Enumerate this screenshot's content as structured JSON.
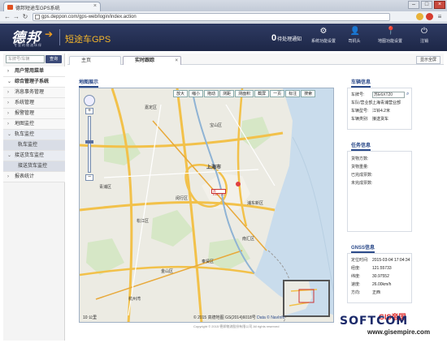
{
  "browser": {
    "tab_title": "德邦短途车GPS系统",
    "url": "gps.deppon.com/gps-web/login/index.action",
    "back_icon": "back-icon",
    "forward_icon": "forward-icon",
    "reload_icon": "reload-icon"
  },
  "header": {
    "logo_text": "德邦",
    "logo_sub": "专业的物流伙伴",
    "app_title": "短途车GPS",
    "alert_count": "0",
    "alert_label": "待处理通知",
    "items": [
      {
        "label": "系统功能设置",
        "icon": "gear-icon"
      },
      {
        "label": "司机头",
        "icon": "user-icon"
      },
      {
        "label": "地图功能设置",
        "icon": "map-pin-icon"
      },
      {
        "label": "注销",
        "icon": "power-icon"
      }
    ]
  },
  "sidebar": {
    "search_placeholder": "车牌号/车辆",
    "search_button": "查询",
    "items": [
      {
        "label": "用户常用菜单",
        "level": "top"
      },
      {
        "label": "综合管理子系统",
        "level": "top"
      },
      {
        "label": "消息事务管理",
        "level": "sub"
      },
      {
        "label": "系统管理",
        "level": "sub"
      },
      {
        "label": "报警管理",
        "level": "sub"
      },
      {
        "label": "地图监控",
        "level": "sub"
      },
      {
        "label": "轨车监控",
        "level": "sub"
      },
      {
        "label": "轨车监控",
        "level": "leaf"
      },
      {
        "label": "接送货车监控",
        "level": "sub"
      },
      {
        "label": "接送货车监控",
        "level": "leaf"
      },
      {
        "label": "报表统计",
        "level": "sub"
      }
    ]
  },
  "main": {
    "tabs": [
      {
        "label": "主页",
        "closable": false,
        "active": false
      },
      {
        "label": "实时跟踪",
        "closable": true,
        "active": true
      }
    ],
    "fullscreen_label": "显示全屏",
    "map_panel_title": "地图展示",
    "map_toolbar": [
      "放大",
      "缩小",
      "拖动",
      "测距",
      "测面积",
      "截屏",
      "一页",
      "标注",
      "搜索"
    ],
    "map_copyright": "© 2015 高德地图 GS(2014)6018号",
    "map_provider": "Data © NavInfo",
    "scale_label": "10 公里",
    "vehicle_marker": "苏E6XT20",
    "map_labels": [
      "嘉定区",
      "上海市",
      "宝山区",
      "浦东新区",
      "闵行区",
      "松江区",
      "青浦区",
      "奉贤区",
      "金山区",
      "南汇区",
      "杭州湾"
    ],
    "vehicle_info": {
      "title": "车辆信息",
      "rows": [
        {
          "k": "车牌号:",
          "v": "苏E6XT20"
        },
        {
          "k": "车队/营业部:",
          "v": "上海青浦营业部"
        },
        {
          "k": "车辆型号:",
          "v": "江铃4.2米"
        },
        {
          "k": "车辆类别:",
          "v": "接送货车"
        }
      ]
    },
    "task_info": {
      "title": "任务信息",
      "rows": [
        {
          "k": "货物方数:",
          "v": ""
        },
        {
          "k": "货物重量:",
          "v": ""
        },
        {
          "k": "已完成票数:",
          "v": ""
        },
        {
          "k": "未完成票数:",
          "v": ""
        }
      ]
    },
    "gnss_info": {
      "title": "GNSS信息",
      "rows": [
        {
          "k": "定位时间:",
          "v": "2015-03-04 17:04:34"
        },
        {
          "k": "经度:",
          "v": "121.55733"
        },
        {
          "k": "纬度:",
          "v": "30.97552"
        },
        {
          "k": "速度:",
          "v": "26.00km/h"
        },
        {
          "k": "方向:",
          "v": "正西"
        }
      ]
    },
    "footer": "Copyright © 2015 德邦物流股份有限公司 All rights reserved"
  },
  "watermark": {
    "main": "SOFTCOM",
    "site": "www.gisempire.com",
    "cn": "GIS帝国"
  },
  "colors": {
    "header_bg": "#1d2747",
    "title_accent": "#f3b52a",
    "panel_title": "#2b4a8a"
  }
}
